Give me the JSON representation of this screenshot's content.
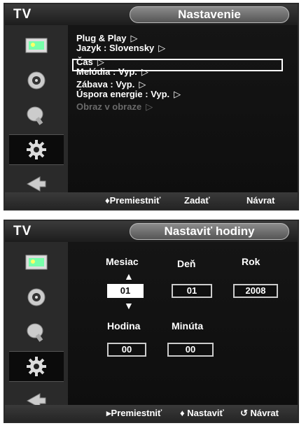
{
  "panel1": {
    "tv_label": "TV",
    "title": "Nastavenie",
    "menu": [
      {
        "label": "Plug & Play",
        "arrow": "▷"
      },
      {
        "label": "Jazyk : Slovensky",
        "arrow": "▷"
      },
      {
        "label": "Čas",
        "arrow": "▷"
      },
      {
        "label": "Melódia : Vyp.",
        "arrow": "▷"
      },
      {
        "label": "Zábava : Vyp.",
        "arrow": "▷"
      },
      {
        "label": "Úspora energie : Vyp.",
        "arrow": "▷"
      },
      {
        "label": "Obraz v obraze",
        "arrow": "▷"
      }
    ],
    "footer": {
      "move": "♦Premiestniť",
      "enter": "Zadať",
      "return": "Návrat"
    }
  },
  "panel2": {
    "tv_label": "TV",
    "title": "Nastaviť hodiny",
    "labels": {
      "month": "Mesiac",
      "day": "Deň",
      "year": "Rok",
      "hour": "Hodina",
      "minute": "Minúta"
    },
    "values": {
      "month": "01",
      "day": "01",
      "year": "2008",
      "hour": "00",
      "minute": "00"
    },
    "up_arrow": "▲",
    "down_arrow": "▼",
    "footer": {
      "move": "▸Premiestniť",
      "adjust": "♦ Nastaviť",
      "return": "↺ Návrat"
    }
  },
  "icon_names": [
    "picture-icon",
    "sound-icon",
    "channel-icon",
    "setup-icon",
    "input-icon"
  ]
}
